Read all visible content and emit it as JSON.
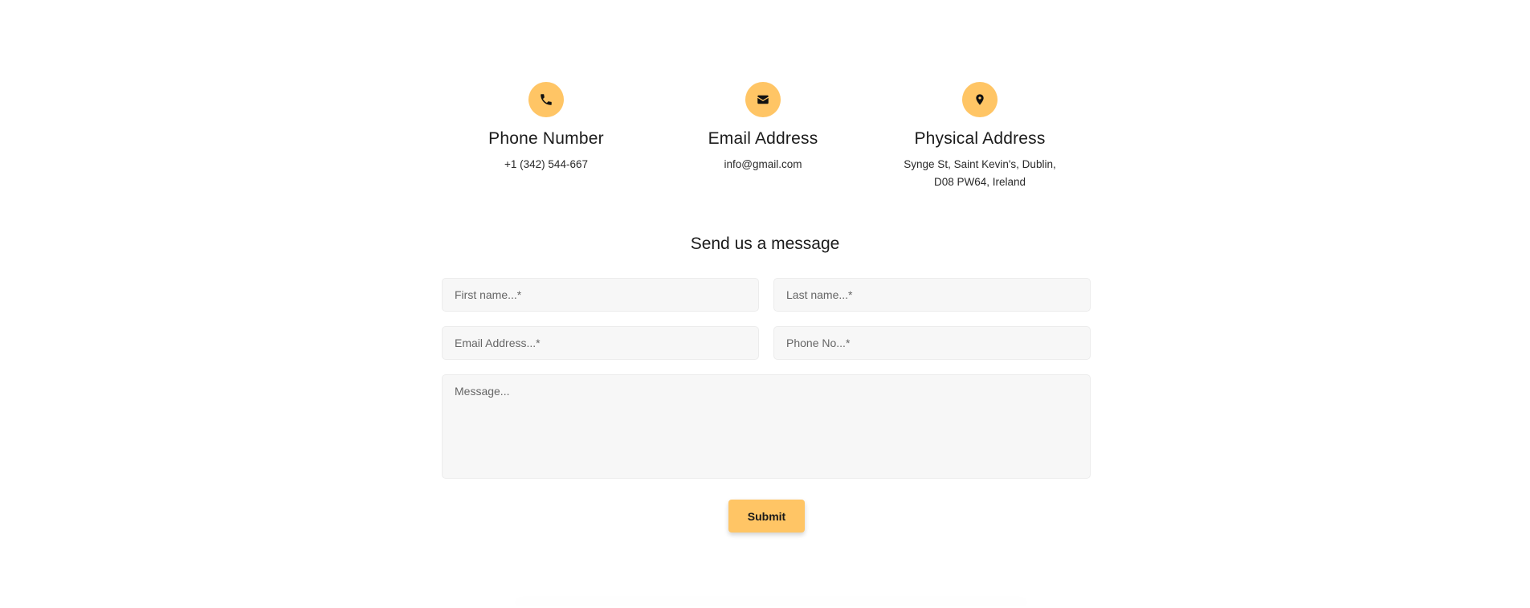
{
  "contact": {
    "phone": {
      "icon": "phone-icon",
      "title": "Phone Number",
      "text": "+1 (342) 544-667"
    },
    "email": {
      "icon": "envelope-icon",
      "title": "Email Address",
      "text": "info@gmail.com"
    },
    "address": {
      "icon": "map-pin-icon",
      "title": "Physical Address",
      "line1": "Synge St, Saint Kevin's, Dublin,",
      "line2": "D08 PW64, Ireland"
    }
  },
  "form": {
    "title": "Send us a message",
    "first_name_placeholder": "First name...*",
    "last_name_placeholder": "Last name...*",
    "email_placeholder": "Email Address...*",
    "phone_placeholder": "Phone No...*",
    "message_placeholder": "Message...",
    "submit_label": "Submit"
  },
  "colors": {
    "accent": "#ffc565",
    "field_background": "#f7f7f7"
  }
}
